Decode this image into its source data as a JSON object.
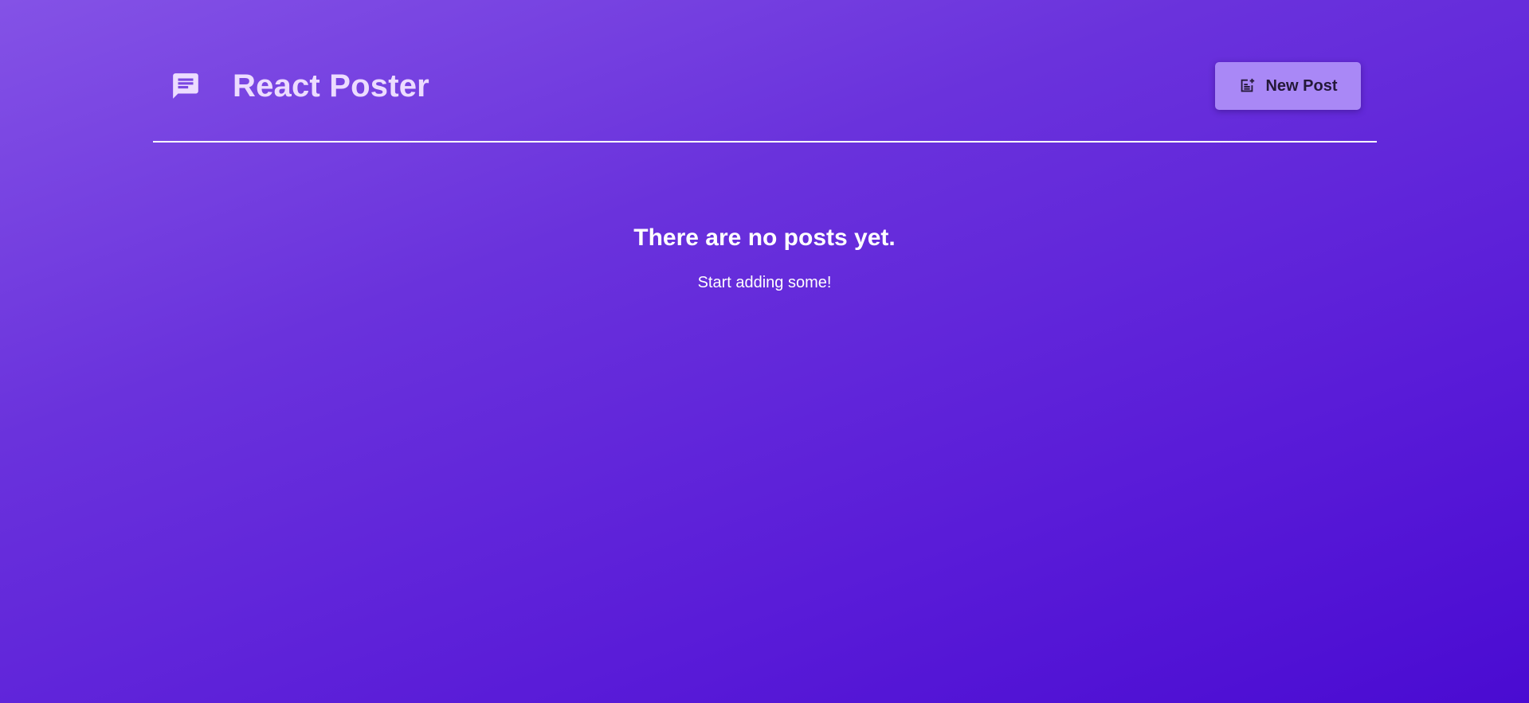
{
  "header": {
    "logo_icon": "message-icon",
    "title": "React Poster",
    "new_post_button": {
      "icon": "note-add-icon",
      "label": "New Post"
    }
  },
  "main": {
    "empty_title": "There are no posts yet.",
    "empty_subtitle": "Start adding some!"
  },
  "colors": {
    "background_gradient_start": "#8452e6",
    "background_gradient_end": "#4a0bd2",
    "title_color": "#ecdcff",
    "button_background": "#a988f6",
    "button_text": "#241838",
    "text": "#ffffff"
  }
}
